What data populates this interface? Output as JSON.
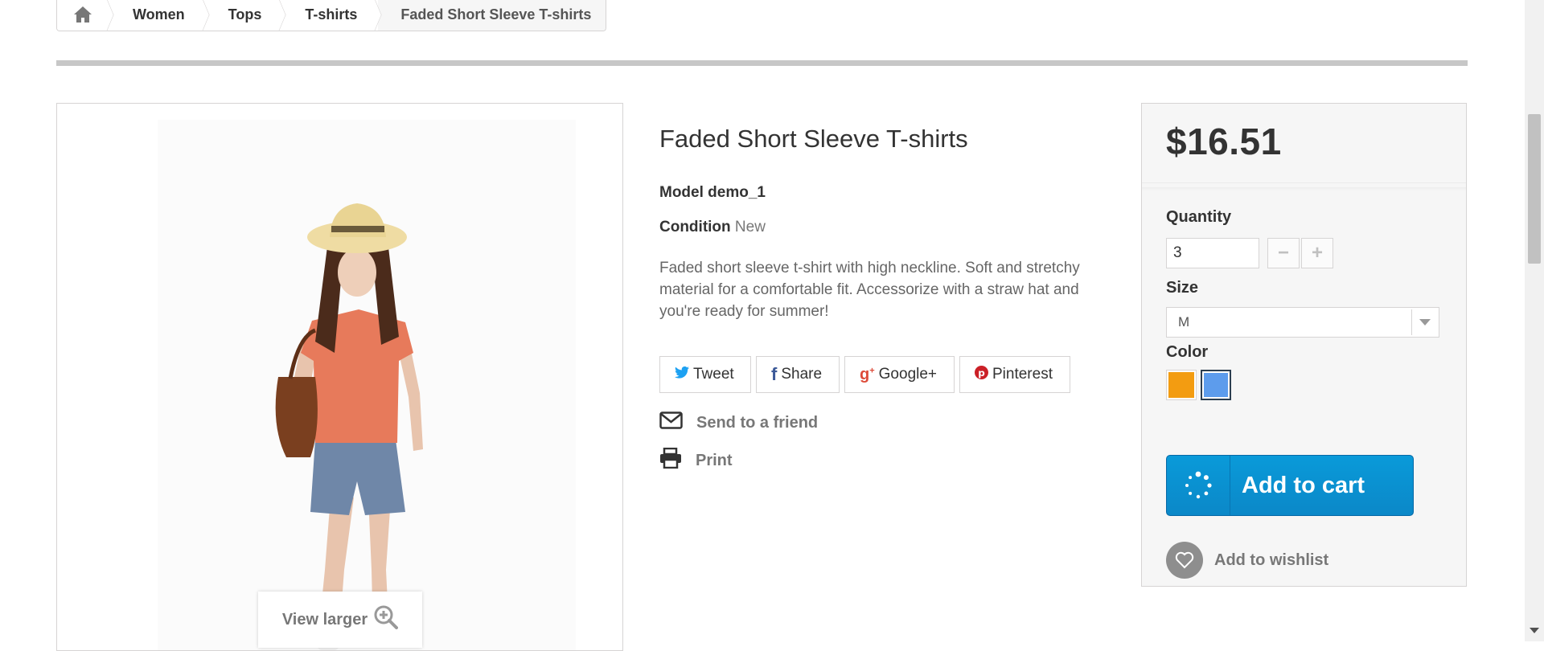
{
  "breadcrumb": {
    "items": [
      "Women",
      "Tops",
      "T-shirts"
    ],
    "current": "Faded Short Sleeve T-shirts"
  },
  "product": {
    "title": "Faded Short Sleeve T-shirts",
    "model_label": "Model demo_1",
    "condition_label": "Condition",
    "condition_value": "New",
    "description": "Faded short sleeve t-shirt with high neckline. Soft and stretchy material for a comfortable fit. Accessorize with a straw hat and you're ready for summer!",
    "view_larger": "View larger"
  },
  "social": {
    "tweet": "Tweet",
    "share": "Share",
    "google": "Google+",
    "pinterest": "Pinterest"
  },
  "actions": {
    "send_to_friend": "Send to a friend",
    "print": "Print"
  },
  "buy": {
    "price": "$16.51",
    "quantity_label": "Quantity",
    "quantity_value": "3",
    "size_label": "Size",
    "size_value": "M",
    "color_label": "Color",
    "colors": [
      "#f39c11",
      "#5d9cec"
    ],
    "selected_color_index": 1,
    "add_to_cart": "Add to cart",
    "add_to_wishlist": "Add to wishlist"
  },
  "colors": {
    "cart_button": "#0a9ad9",
    "twitter": "#1da1f2",
    "facebook": "#3b5998",
    "google": "#dd4b39",
    "pinterest": "#cb2027"
  }
}
